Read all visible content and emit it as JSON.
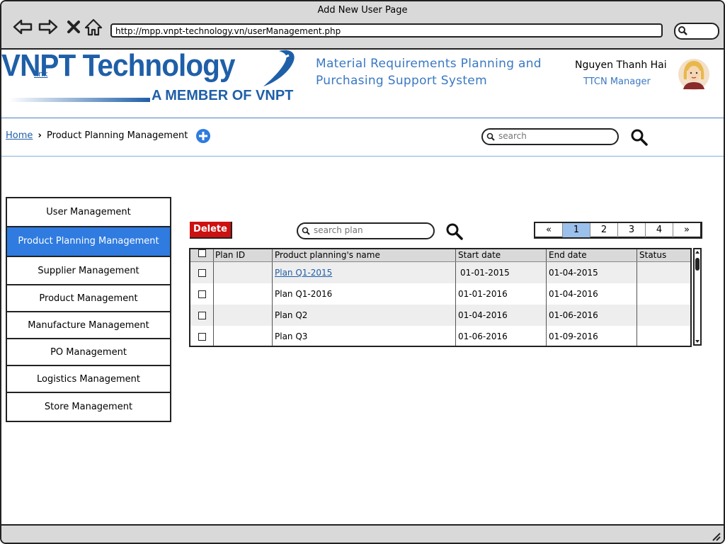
{
  "window": {
    "title": "Add New User Page",
    "url": "http://mpp.vnpt-technology.vn/userManagement.php"
  },
  "header": {
    "logo_main": "VNPT Technology",
    "logo_sub": "A MEMBER OF VNPT",
    "logo_link": "link",
    "system_name_line1": "Material Requirements Planning and",
    "system_name_line2": "Purchasing Support System",
    "user_name": "Nguyen Thanh Hai",
    "user_role": "TTCN Manager"
  },
  "breadcrumb": {
    "home": "Home",
    "separator": "›",
    "current": "Product Planning Management"
  },
  "top_search": {
    "placeholder": "search"
  },
  "sidebar": {
    "items": [
      {
        "label": "User Management"
      },
      {
        "label": "Product Planning Management"
      },
      {
        "label": "Supplier Management"
      },
      {
        "label": "Product Management"
      },
      {
        "label": "Manufacture Management"
      },
      {
        "label": "PO Management"
      },
      {
        "label": "Logistics Management"
      },
      {
        "label": "Store Management"
      }
    ],
    "active_index": 1
  },
  "toolbar": {
    "delete_label": "Delete",
    "search_placeholder": "search plan"
  },
  "pagination": {
    "prev": "«",
    "pages": [
      "1",
      "2",
      "3",
      "4"
    ],
    "current": "1",
    "next": "»"
  },
  "table": {
    "columns": [
      "Plan ID",
      "Product planning's name",
      "Start date",
      "End date",
      "Status"
    ],
    "rows": [
      {
        "plan_id": "",
        "name": "Plan Q1-2015",
        "start": "01-01-2015",
        "end": "01-04-2015",
        "status": "",
        "is_link": true
      },
      {
        "plan_id": "",
        "name": "Plan Q1-2016",
        "start": "01-01-2016",
        "end": "01-04-2016",
        "status": "",
        "is_link": false
      },
      {
        "plan_id": "",
        "name": "Plan Q2",
        "start": "01-04-2016",
        "end": "01-06-2016",
        "status": "",
        "is_link": false
      },
      {
        "plan_id": "",
        "name": "Plan Q3",
        "start": "01-06-2016",
        "end": "01-09-2016",
        "status": "",
        "is_link": false
      }
    ]
  },
  "colors": {
    "brand": "#1f5fa8",
    "accent": "#2f7be0",
    "danger": "#cc1111",
    "page_current": "#9cc0ec"
  }
}
